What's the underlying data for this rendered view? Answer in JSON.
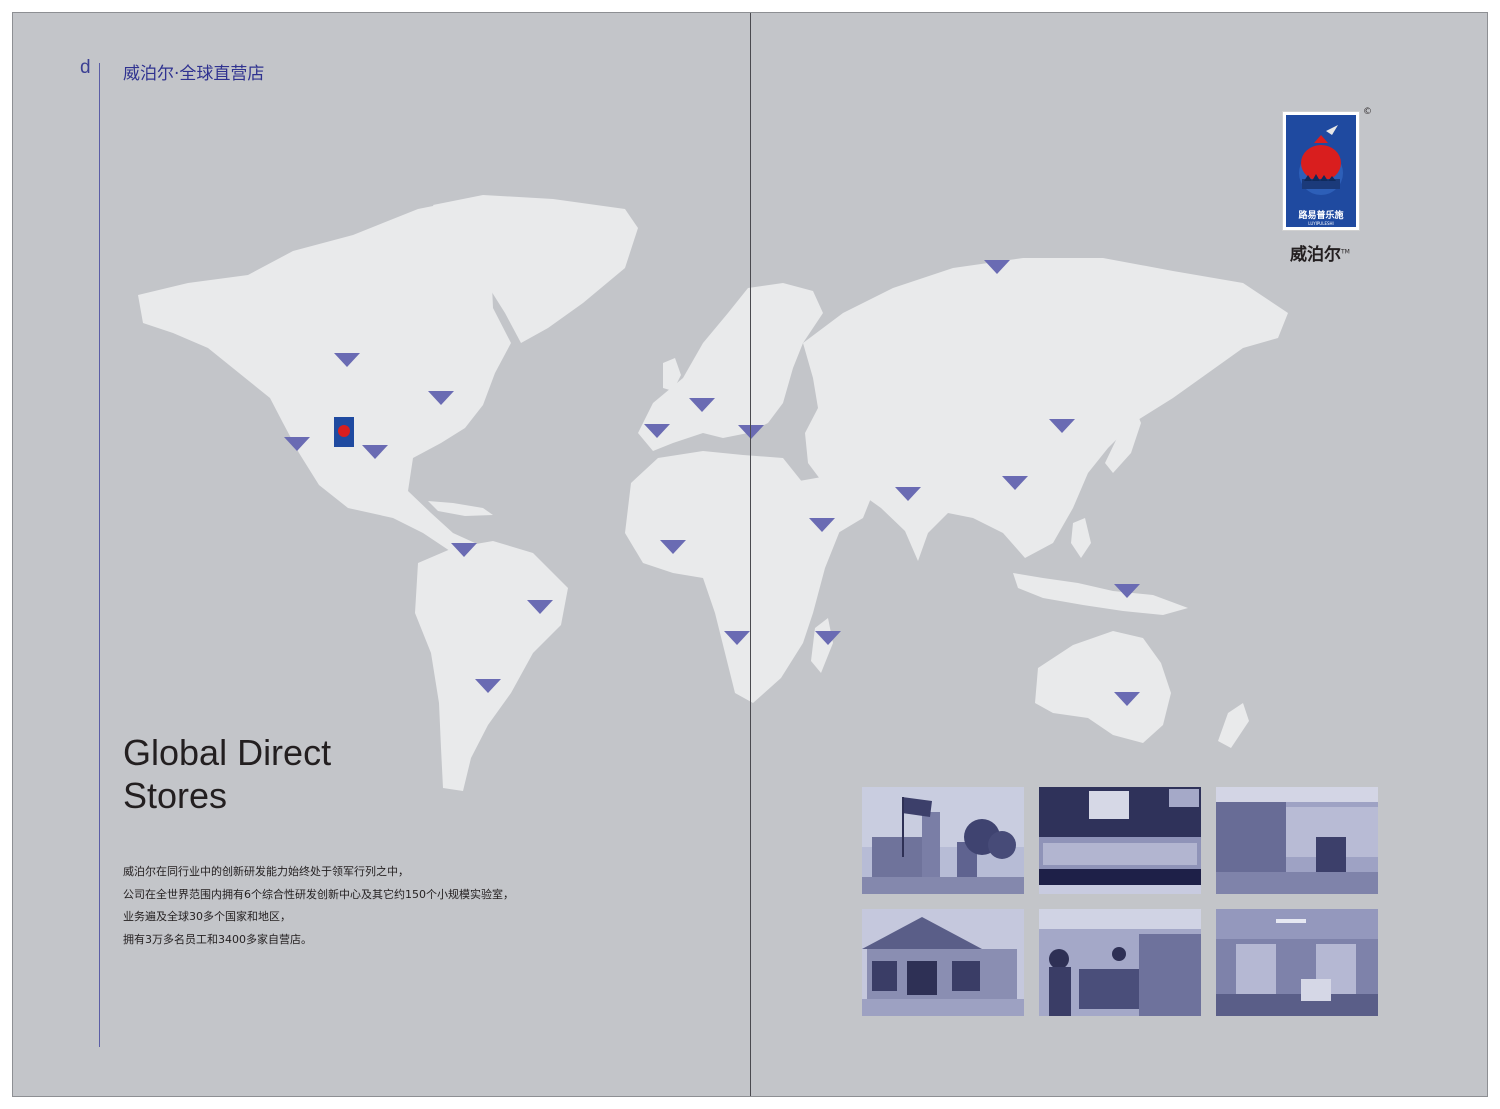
{
  "page": {
    "page_letter": "d",
    "section_title": "威泊尔·全球直营店",
    "heading_lines": [
      "Global Direct",
      "Stores"
    ],
    "body_lines": [
      "威泊尔在同行业中的创新研发能力始终处于领军行列之中，",
      "公司在全世界范围内拥有6个综合性研发创新中心及其它约150个小规模实验室，",
      "业务遍及全球30多个国家和地区，",
      "拥有3万多名员工和3400多家自营店。"
    ]
  },
  "logo": {
    "label": "路易普乐施",
    "sublabel": "LUYIPULESHI",
    "copyright": "©",
    "brand": "威泊尔",
    "trademark": "TM"
  },
  "map": {
    "marker_icon": "triangle-down-marker-icon",
    "markers": [
      {
        "id": "canada-west"
      },
      {
        "id": "canada-east"
      },
      {
        "id": "usa-west"
      },
      {
        "id": "usa-central"
      },
      {
        "id": "colombia"
      },
      {
        "id": "brazil"
      },
      {
        "id": "argentina"
      },
      {
        "id": "spain"
      },
      {
        "id": "central-europe"
      },
      {
        "id": "turkey"
      },
      {
        "id": "nigeria"
      },
      {
        "id": "angola"
      },
      {
        "id": "madagascar"
      },
      {
        "id": "horn-of-africa"
      },
      {
        "id": "russia"
      },
      {
        "id": "india"
      },
      {
        "id": "china"
      },
      {
        "id": "korea"
      },
      {
        "id": "indonesia"
      },
      {
        "id": "australia"
      }
    ]
  },
  "colors": {
    "background": "#c3c5c9",
    "land": "#e9eaeb",
    "marker": "#6a6bb3",
    "accent": "#2f3290",
    "text": "#231f20"
  },
  "photos": [
    {
      "id": "building-flags"
    },
    {
      "id": "sherwin-williams-storefront"
    },
    {
      "id": "store-interior-staff"
    },
    {
      "id": "store-exterior"
    },
    {
      "id": "store-interior-customers"
    },
    {
      "id": "showroom"
    }
  ]
}
